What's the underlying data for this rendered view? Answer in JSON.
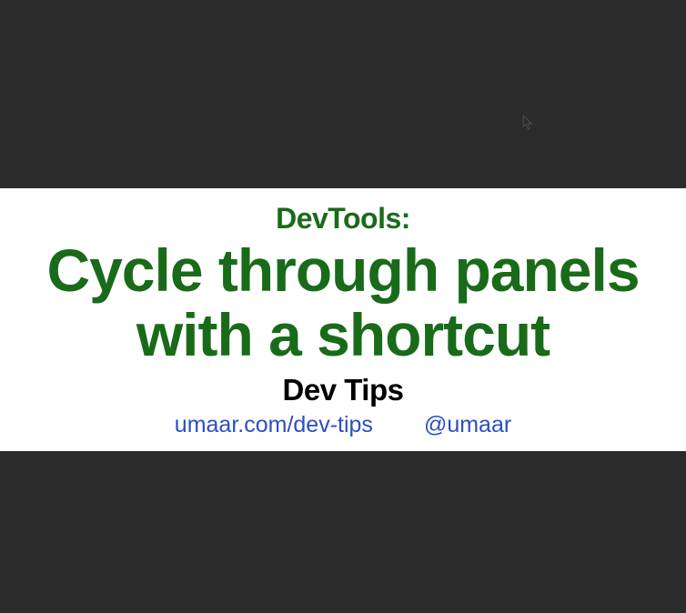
{
  "card": {
    "subtitle": "DevTools:",
    "title": "Cycle through panels with a shortcut",
    "series": "Dev Tips",
    "link_site": "umaar.com/dev-tips",
    "link_handle": "@umaar"
  },
  "colors": {
    "background_dark": "#2b2b2b",
    "band_bg": "#ffffff",
    "heading_green": "#196b1a",
    "link_blue": "#2a4fc3",
    "series_black": "#000000"
  }
}
